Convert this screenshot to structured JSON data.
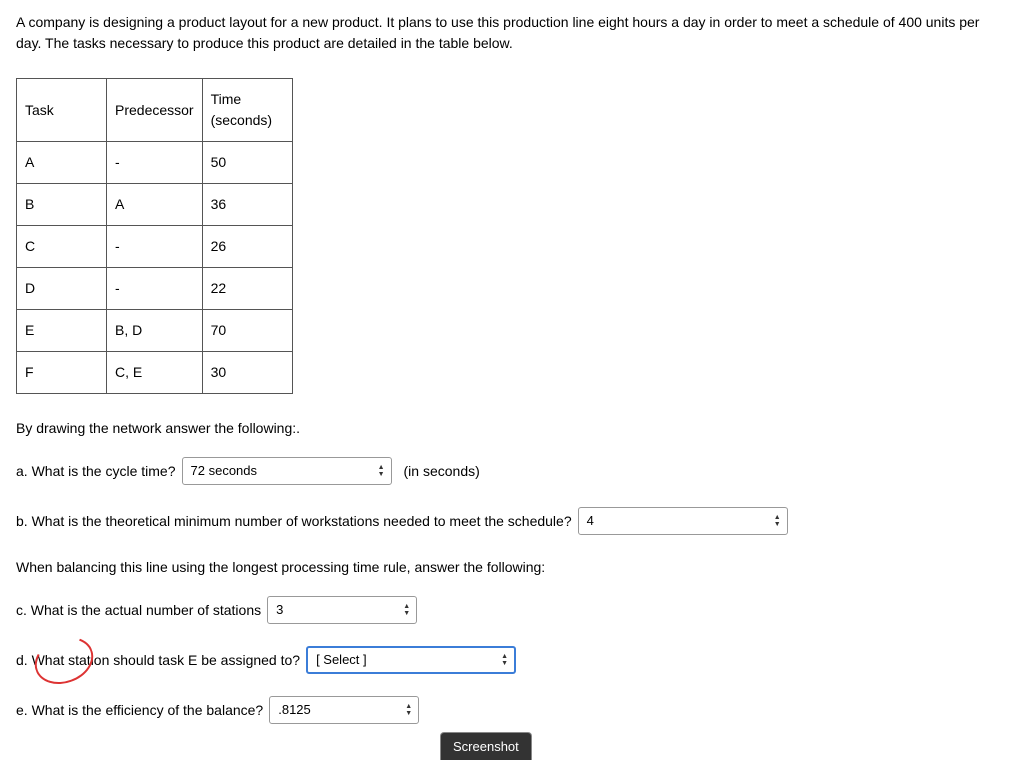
{
  "intro": "A company is designing a product layout for a new product. It plans to use this production line eight hours a day in order to meet a schedule of 400 units per day. The tasks necessary to produce this product are detailed in the table below.",
  "table": {
    "headers": {
      "task": "Task",
      "predecessor": "Predecessor",
      "time": "Time (seconds)"
    },
    "rows": [
      {
        "task": "A",
        "predecessor": "-",
        "time": "50"
      },
      {
        "task": "B",
        "predecessor": "A",
        "time": "36"
      },
      {
        "task": "C",
        "predecessor": "-",
        "time": "26"
      },
      {
        "task": "D",
        "predecessor": "-",
        "time": "22"
      },
      {
        "task": "E",
        "predecessor": "B, D",
        "time": "70"
      },
      {
        "task": "F",
        "predecessor": "C, E",
        "time": "30"
      }
    ]
  },
  "instruction1": "By drawing the network answer the following:.",
  "qa": {
    "label": "a. What is the cycle time?",
    "value": "72 seconds",
    "suffix": "(in seconds)"
  },
  "qb": {
    "label": "b. What is the theoretical minimum number of workstations needed to meet the schedule?",
    "value": "4"
  },
  "instruction2": "When balancing this line using the longest processing time rule, answer the following:",
  "qc": {
    "label": "c. What is the actual number of stations",
    "value": "3"
  },
  "qd": {
    "label": "d. What station should task E be assigned to?",
    "value": "[ Select ]"
  },
  "qe": {
    "label": "e. What is the efficiency of the balance?",
    "value": ".8125"
  },
  "screenshot": "Screenshot"
}
